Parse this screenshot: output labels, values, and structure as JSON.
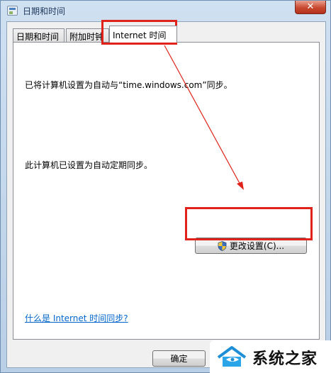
{
  "window": {
    "title": "日期和时间",
    "close_symbol": "✕"
  },
  "tabs": [
    {
      "label": "日期和时间"
    },
    {
      "label": "附加时钟"
    },
    {
      "label": "Internet 时间"
    }
  ],
  "panel": {
    "status_text": "已将计算机设置为自动与“time.windows.com”同步。",
    "sync_text": "此计算机已设置为自动定期同步。",
    "change_button_label": "更改设置(C)...",
    "help_link": "什么是 Internet 时间同步?"
  },
  "footer": {
    "ok_label": "确定"
  },
  "watermark": {
    "text": "系统之家"
  },
  "colors": {
    "annotation": "#e0231a",
    "link": "#0066cc"
  },
  "icons": {
    "app": "calendar-clock-icon",
    "change_button": "uac-shield-icon",
    "close": "close-icon"
  }
}
